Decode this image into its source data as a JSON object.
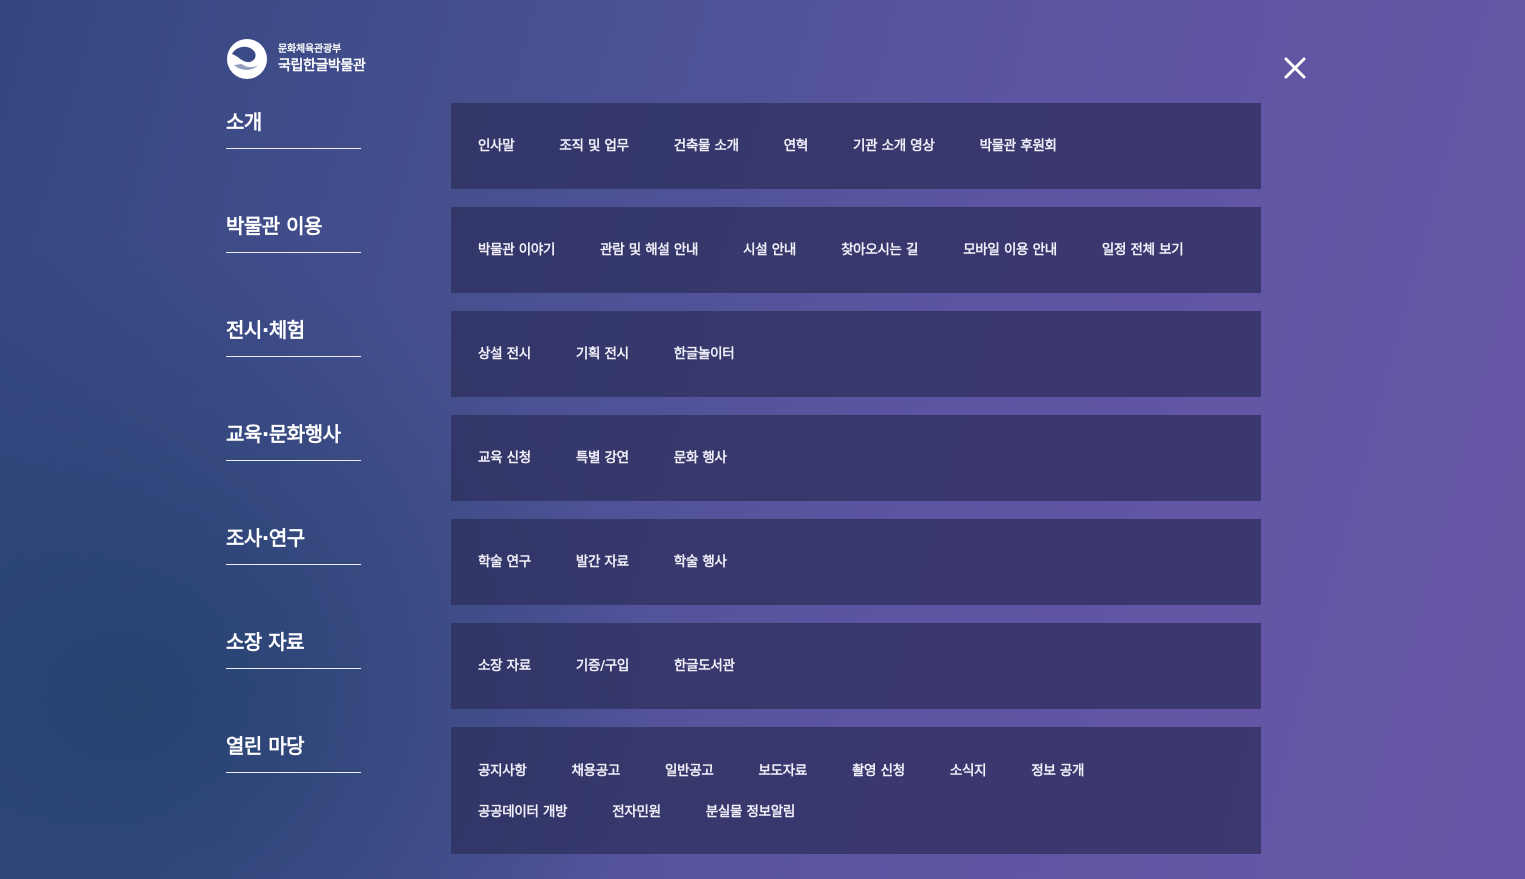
{
  "logo": {
    "ministry": "문화체육관광부",
    "museum": "국립한글박물관"
  },
  "close_icon": "close-icon",
  "menu": [
    {
      "title": "소개",
      "items": [
        "인사말",
        "조직 및 업무",
        "건축물 소개",
        "연혁",
        "기관 소개 영상",
        "박물관 후원회"
      ]
    },
    {
      "title": "박물관 이용",
      "items": [
        "박물관 이야기",
        "관람 및 해설 안내",
        "시설 안내",
        "찾아오시는 길",
        "모바일 이용 안내",
        "일정 전체 보기"
      ]
    },
    {
      "title": "전시·체험",
      "items": [
        "상설 전시",
        "기획 전시",
        "한글놀이터"
      ]
    },
    {
      "title": "교육·문화행사",
      "items": [
        "교육 신청",
        "특별 강연",
        "문화 행사"
      ]
    },
    {
      "title": "조사·연구",
      "items": [
        "학술 연구",
        "발간 자료",
        "학술 행사"
      ]
    },
    {
      "title": "소장 자료",
      "items": [
        "소장 자료",
        "기증/구입",
        "한글도서관"
      ]
    },
    {
      "title": "열린 마당",
      "items": [
        "공지사항",
        "채용공고",
        "일반공고",
        "보도자료",
        "촬영 신청",
        "소식지",
        "정보 공개",
        "공공데이터 개방",
        "전자민원",
        "분실물 정보알림"
      ]
    }
  ]
}
